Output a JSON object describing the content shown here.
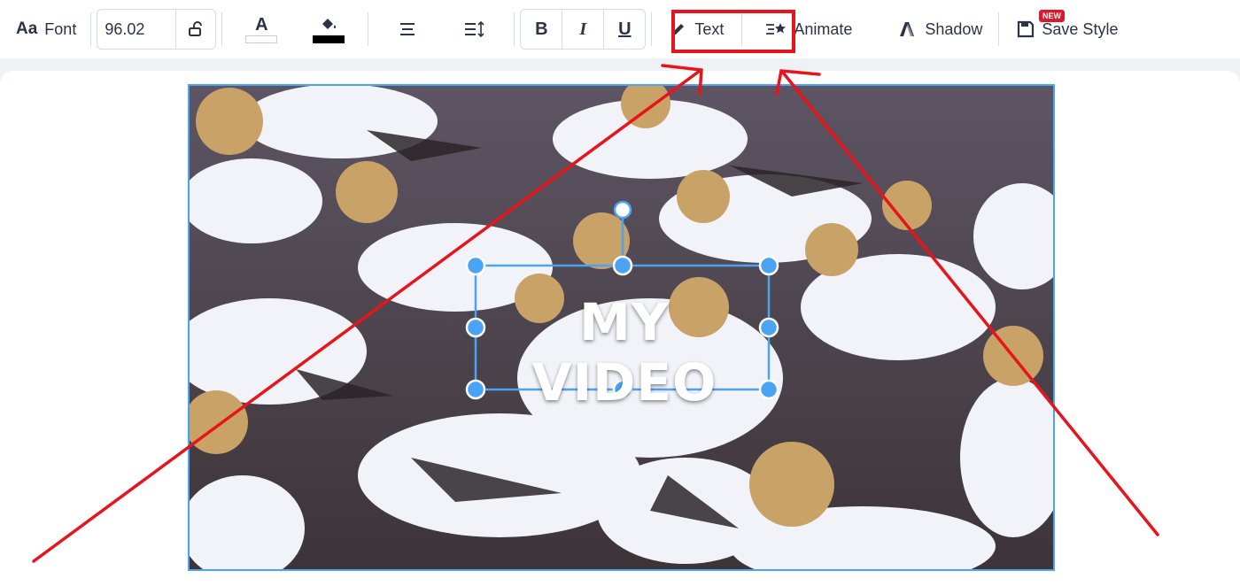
{
  "toolbar": {
    "font_icon": "Aa",
    "font_label": "Font",
    "font_size": "96.02",
    "text_color_glyph": "A",
    "bold": "B",
    "italic": "I",
    "underline": "U",
    "text_label": "Text",
    "animate_label": "Animate",
    "shadow_label": "Shadow",
    "save_style_label": "Save Style",
    "new_badge": "NEW"
  },
  "canvas": {
    "caption_text": "MY VIDEO"
  },
  "colors": {
    "accent_blue": "#4aa3f5",
    "highlight_red": "#e8141c",
    "badge_red": "#e0162b",
    "text_color_swatch": "#ffffff",
    "fill_color_swatch": "#000000"
  }
}
